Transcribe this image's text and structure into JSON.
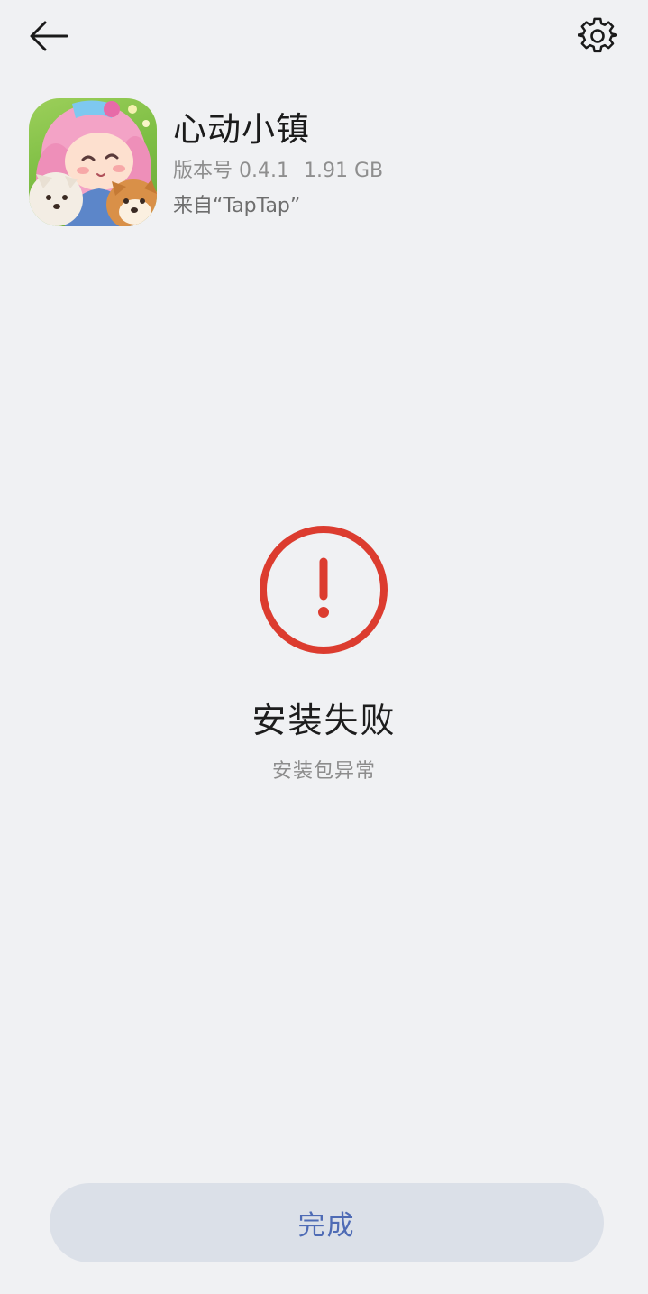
{
  "header": {
    "back_icon": "arrow-left-icon",
    "settings_icon": "gear-icon"
  },
  "app": {
    "name": "心动小镇",
    "version_label": "版本号 0.4.1",
    "size": "1.91 GB",
    "source": "来自“TapTap”",
    "icon": "app-icon-character-with-dogs"
  },
  "result": {
    "status_icon": "error-exclamation-icon",
    "title": "安装失败",
    "subtitle": "安装包异常",
    "accent_color": "#dc3c2f"
  },
  "footer": {
    "done_label": "完成"
  }
}
